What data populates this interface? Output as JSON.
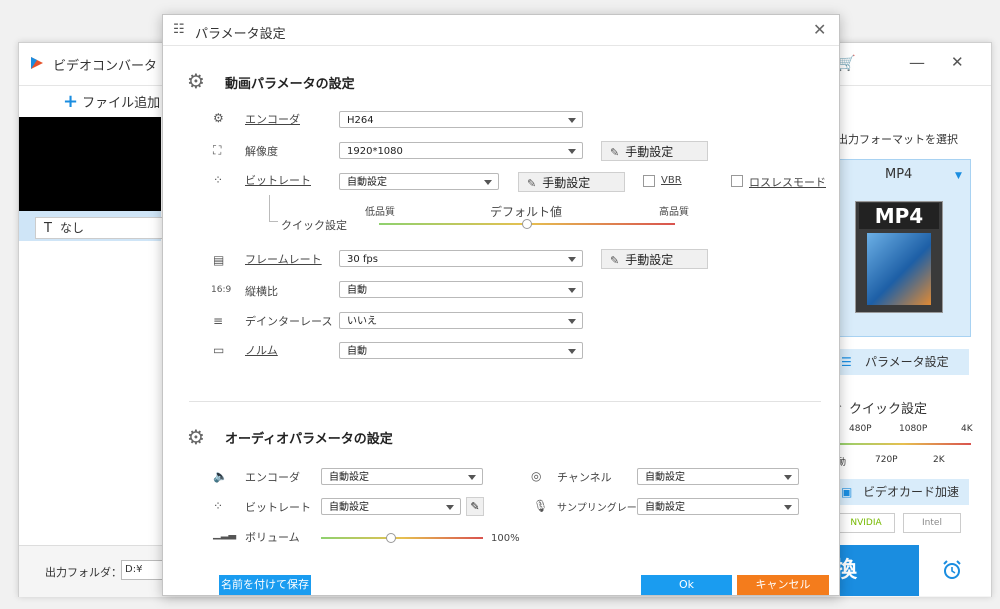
{
  "app": {
    "title": "ビデオコンバータ",
    "add_file": "ファイル追加",
    "subtitle_value": "なし",
    "output_folder_label": "出力フォルダ：",
    "output_folder_value": "D:¥",
    "convert_label": "換",
    "right_panel": {
      "format_select_label": "出力フォーマットを選択",
      "format_name": "MP4",
      "format_thumb_title": "MP4",
      "param_button": "パラメータ設定",
      "quick_setting": "クイック設定",
      "quick_top": [
        "480P",
        "1080P",
        "4K"
      ],
      "quick_bottom": [
        "動",
        "720P",
        "2K"
      ],
      "gpu_button": "ビデオカード加速",
      "vendor_nvidia": "NVIDIA",
      "vendor_intel": "Intel"
    }
  },
  "dialog": {
    "title": "パラメータ設定",
    "video_section": "動画パラメータの設定",
    "video": {
      "encoder": {
        "label": "エンコーダ",
        "value": "H264"
      },
      "resolution": {
        "label": "解像度",
        "value": "1920*1080"
      },
      "bitrate": {
        "label": "ビットレート",
        "value": "自動設定"
      },
      "quick_setting": {
        "label": "クイック設定",
        "low": "低品質",
        "default": "デフォルト値",
        "high": "高品質",
        "level": 0.5
      },
      "framerate": {
        "label": "フレームレート",
        "value": "30 fps"
      },
      "aspect": {
        "label": "縦横比",
        "value": "自動"
      },
      "deinterlace": {
        "label": "デインターレース",
        "value": "いいえ"
      },
      "norm": {
        "label": "ノルム",
        "value": "自動"
      },
      "manual_button": "手動設定",
      "vbr": "VBR",
      "lossless": "ロスレスモード"
    },
    "audio_section": "オーディオパラメータの設定",
    "audio": {
      "encoder": {
        "label": "エンコーダ",
        "value": "自動設定"
      },
      "bitrate": {
        "label": "ビットレート",
        "value": "自動設定"
      },
      "volume": {
        "label": "ボリューム",
        "value": "100%",
        "level": 0.43
      },
      "channel": {
        "label": "チャンネル",
        "value": "自動設定"
      },
      "sampling": {
        "label": "サンプリングレート",
        "value": "自動設定"
      }
    },
    "footer": {
      "save_as": "名前を付けて保存",
      "ok": "Ok",
      "cancel": "キャンセル"
    }
  }
}
